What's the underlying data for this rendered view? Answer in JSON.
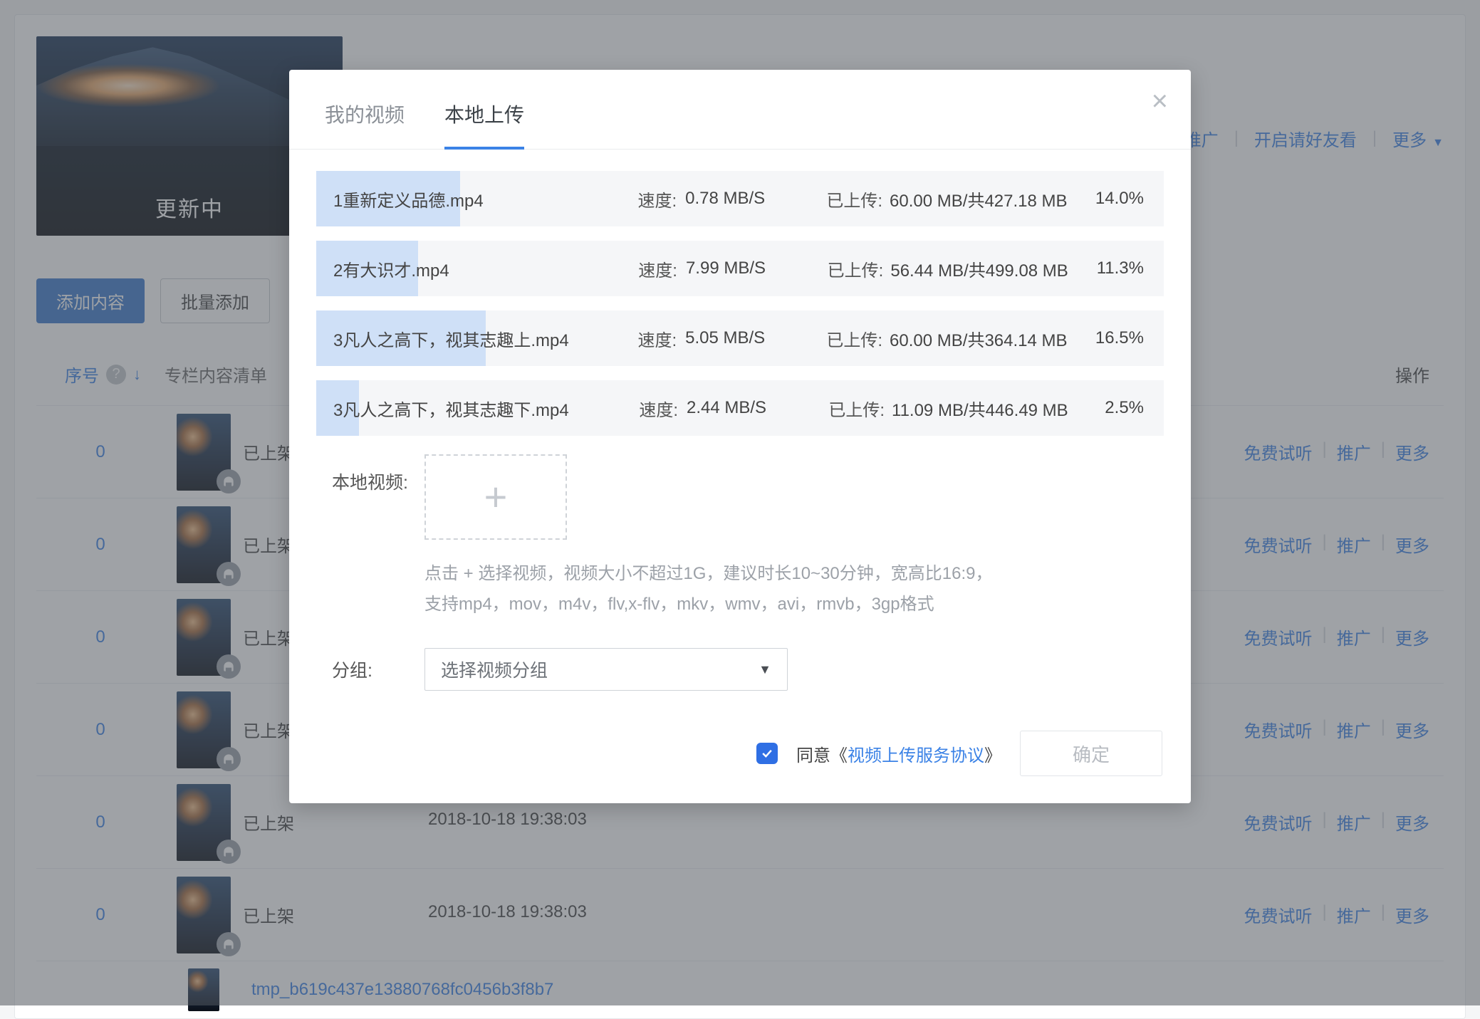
{
  "header": {
    "cover_status": "更新中",
    "links": {
      "promote": "推广",
      "invite": "开启请好友看",
      "more": "更多"
    }
  },
  "buttons": {
    "add": "添加内容",
    "batch": "批量添加"
  },
  "table": {
    "th_index": "序号",
    "th_title": "专栏内容清单",
    "th_ops": "操作",
    "status_text": "已上架",
    "date_text": "2018-10-18 19:38:03",
    "ops": {
      "free": "免费试听",
      "promote": "推广",
      "more": "更多"
    },
    "rows": [
      {
        "idx": "0"
      },
      {
        "idx": "0"
      },
      {
        "idx": "0"
      },
      {
        "idx": "0"
      },
      {
        "idx": "0"
      },
      {
        "idx": "0"
      }
    ],
    "tmp_link": "tmp_b619c437e13880768fc0456b3f8b7"
  },
  "modal": {
    "tabs": {
      "my": "我的视频",
      "local": "本地上传"
    },
    "speed_label": "速度:",
    "uploaded_label": "已上传:",
    "uploads": [
      {
        "name": "1重新定义品德.mp4",
        "speed": "0.78 MB/S",
        "uploaded": "60.00 MB/共427.18 MB",
        "pct": "14.0%",
        "fill": 17
      },
      {
        "name": "2有大识才.mp4",
        "speed": "7.99 MB/S",
        "uploaded": "56.44 MB/共499.08 MB",
        "pct": "11.3%",
        "fill": 12
      },
      {
        "name": "3凡人之高下，视其志趣上.mp4",
        "speed": "5.05 MB/S",
        "uploaded": "60.00 MB/共364.14 MB",
        "pct": "16.5%",
        "fill": 20
      },
      {
        "name": "3凡人之高下，视其志趣下.mp4",
        "speed": "2.44 MB/S",
        "uploaded": "11.09 MB/共446.49 MB",
        "pct": "2.5%",
        "fill": 5
      }
    ],
    "local_video_label": "本地视频:",
    "hint_line1": "点击 + 选择视频，视频大小不超过1G，建议时长10~30分钟，宽高比16:9，",
    "hint_line2": "支持mp4，mov，m4v，flv,x-flv，mkv，wmv，avi，rmvb，3gp格式",
    "group_label": "分组:",
    "group_placeholder": "选择视频分组",
    "agree_prefix": "同意《",
    "agree_link": "视频上传服务协议",
    "agree_suffix": "》",
    "confirm": "确定"
  }
}
